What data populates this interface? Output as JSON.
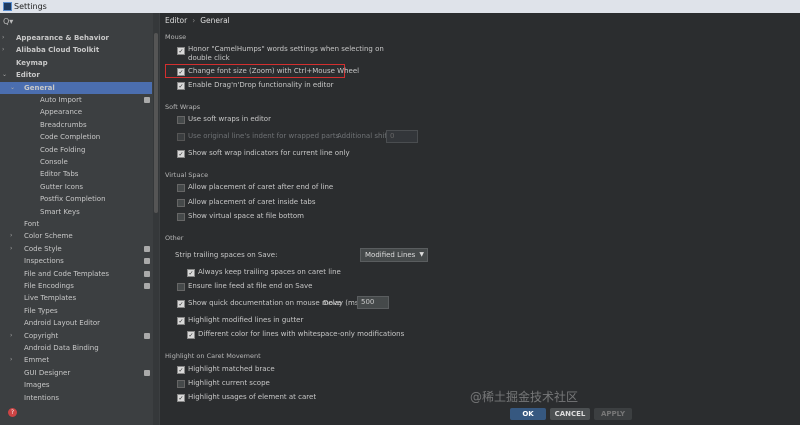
{
  "window": {
    "title": "Settings"
  },
  "search": {
    "icon": "search-icon",
    "label": "Q▾"
  },
  "tree": [
    {
      "label": "Appearance & Behavior",
      "level": 0,
      "arrow": "›",
      "bold": true
    },
    {
      "label": "Alibaba Cloud Toolkit",
      "level": 0,
      "arrow": "›",
      "bold": true
    },
    {
      "label": "Keymap",
      "level": 0,
      "arrow": "",
      "bold": true
    },
    {
      "label": "Editor",
      "level": 0,
      "arrow": "⌄",
      "bold": true
    },
    {
      "label": "General",
      "level": 1,
      "arrow": "⌄",
      "bold": true,
      "selected": true
    },
    {
      "label": "Auto Import",
      "level": 2,
      "badge": true
    },
    {
      "label": "Appearance",
      "level": 2
    },
    {
      "label": "Breadcrumbs",
      "level": 2
    },
    {
      "label": "Code Completion",
      "level": 2
    },
    {
      "label": "Code Folding",
      "level": 2
    },
    {
      "label": "Console",
      "level": 2
    },
    {
      "label": "Editor Tabs",
      "level": 2
    },
    {
      "label": "Gutter Icons",
      "level": 2
    },
    {
      "label": "Postfix Completion",
      "level": 2
    },
    {
      "label": "Smart Keys",
      "level": 2
    },
    {
      "label": "Font",
      "level": 1
    },
    {
      "label": "Color Scheme",
      "level": 1,
      "arrow": "›"
    },
    {
      "label": "Code Style",
      "level": 1,
      "arrow": "›",
      "badge": true
    },
    {
      "label": "Inspections",
      "level": 1,
      "badge": true
    },
    {
      "label": "File and Code Templates",
      "level": 1,
      "badge": true
    },
    {
      "label": "File Encodings",
      "level": 1,
      "badge": true
    },
    {
      "label": "Live Templates",
      "level": 1
    },
    {
      "label": "File Types",
      "level": 1
    },
    {
      "label": "Android Layout Editor",
      "level": 1
    },
    {
      "label": "Copyright",
      "level": 1,
      "arrow": "›",
      "badge": true
    },
    {
      "label": "Android Data Binding",
      "level": 1
    },
    {
      "label": "Emmet",
      "level": 1,
      "arrow": "›"
    },
    {
      "label": "GUI Designer",
      "level": 1,
      "badge": true
    },
    {
      "label": "Images",
      "level": 1
    },
    {
      "label": "Intentions",
      "level": 1
    }
  ],
  "breadcrumb": {
    "part1": "Editor",
    "sep": "›",
    "part2": "General"
  },
  "sections": {
    "mouse": "Mouse",
    "soft_wraps": "Soft Wraps",
    "virtual_space": "Virtual Space",
    "other": "Other",
    "highlight": "Highlight on Caret Movement"
  },
  "options": {
    "camel_line1": "Honor \"CamelHumps\" words settings when selecting on",
    "camel_line2": "double click",
    "zoom": "Change font size (Zoom) with Ctrl+Mouse Wheel",
    "dnd": "Enable Drag'n'Drop functionality in editor",
    "soft_wrap_editor": "Use soft wraps in editor",
    "orig_indent": "Use original line's indent for wrapped parts",
    "additional_shift_label": "Additional shift:",
    "additional_shift_value": "0",
    "show_soft_wrap": "Show soft wrap indicators for current line only",
    "caret_after_eol": "Allow placement of caret after end of line",
    "caret_inside_tabs": "Allow placement of caret inside tabs",
    "virtual_space_end": "Show virtual space at file bottom",
    "strip_trailing_label": "Strip trailing spaces on Save:",
    "strip_trailing_value": "Modified Lines",
    "keep_trailing": "Always keep trailing spaces on caret line",
    "ensure_lf": "Ensure line feed at file end on Save",
    "quick_doc": "Show quick documentation on mouse move",
    "delay_label": "Delay (ms):",
    "delay_value": "500",
    "highlight_modified": "Highlight modified lines in gutter",
    "different_color": "Different color for lines with whitespace-only modifications",
    "matched_brace": "Highlight matched brace",
    "current_scope": "Highlight current scope",
    "usages": "Highlight usages of element at caret"
  },
  "buttons": {
    "ok": "OK",
    "cancel": "CANCEL",
    "apply": "APPLY"
  },
  "watermark": "@稀土掘金技术社区",
  "colors": {
    "selection": "#4b6eaf",
    "highlight_box": "#d32f2f",
    "ok_button": "#365880"
  }
}
